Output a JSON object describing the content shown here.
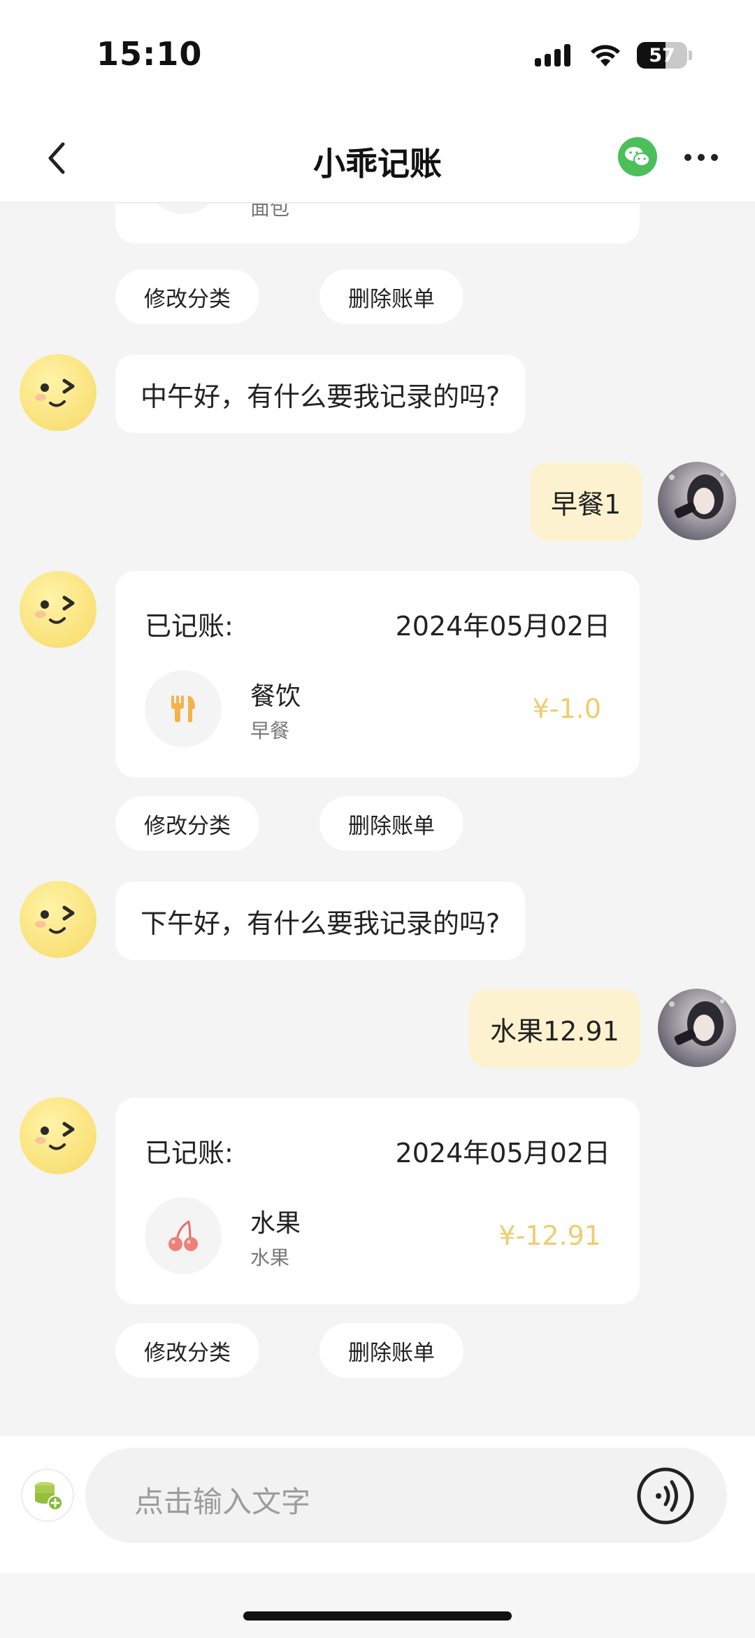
{
  "status_bar": {
    "time": "15:10",
    "battery": "57",
    "battery_level": 0.57
  },
  "nav": {
    "title": "小乖记账",
    "back_icon": "chevron-left-icon",
    "wechat_icon": "wechat-icon",
    "more_icon": "more-dots-icon"
  },
  "partial_record": {
    "subcategory": "面包"
  },
  "actions": {
    "edit_label": "修改分类",
    "delete_label": "删除账单"
  },
  "messages": {
    "greeting_noon": "中午好，有什么要我记录的吗?",
    "user_breakfast": "早餐1",
    "greeting_afternoon": "下午好，有什么要我记录的吗?",
    "user_fruit": "水果12.91"
  },
  "records": [
    {
      "label": "已记账:",
      "date": "2024年05月02日",
      "category": "餐饮",
      "subcategory": "早餐",
      "amount": "¥-1.0",
      "icon": "fork-knife-icon"
    },
    {
      "label": "已记账:",
      "date": "2024年05月02日",
      "category": "水果",
      "subcategory": "水果",
      "amount": "¥-12.91",
      "icon": "cherry-icon"
    }
  ],
  "input": {
    "placeholder": "点击输入文字",
    "add_icon": "database-add-icon",
    "voice_icon": "voice-icon"
  },
  "colors": {
    "accent_amount": "#f0cc6e",
    "user_bubble": "#fdf2cf",
    "bot_avatar": "#fbe582",
    "wechat_green": "#4cbf5a"
  }
}
